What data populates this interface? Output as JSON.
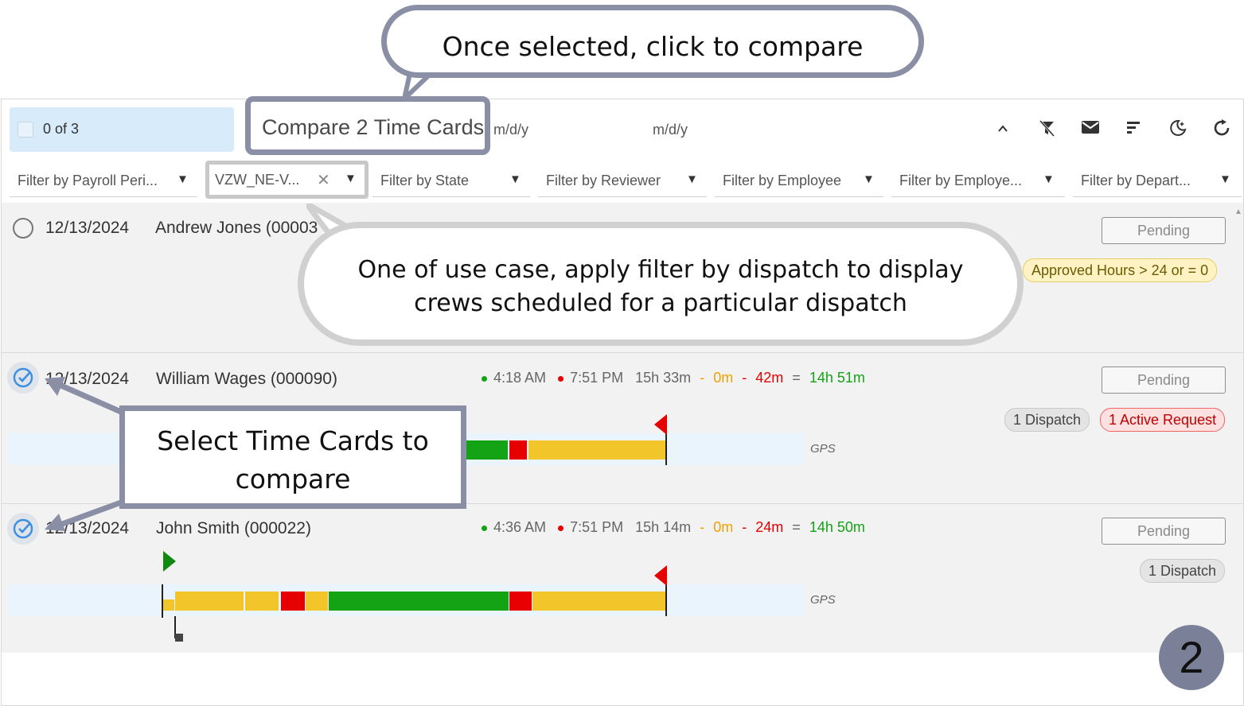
{
  "selection": {
    "count_label": "0 of 3"
  },
  "compare_button": {
    "label": "Compare 2 Time Cards"
  },
  "dates": {
    "start_placeholder": "m/d/y",
    "end_placeholder": "m/d/y"
  },
  "filters": [
    {
      "label": "Filter by Payroll Peri..."
    },
    {
      "label": "VZW_NE-V...",
      "clear": "✕"
    },
    {
      "label": "Filter by State"
    },
    {
      "label": "Filter by Reviewer"
    },
    {
      "label": "Filter by Employee"
    },
    {
      "label": "Filter by Employe..."
    },
    {
      "label": "Filter by Depart..."
    }
  ],
  "rows": [
    {
      "date": "12/13/2024",
      "name": "Andrew Jones (00003",
      "status": "Pending",
      "chips": [
        "Approved Hours > 24 or = 0"
      ]
    },
    {
      "date": "12/13/2024",
      "name": "William Wages (000090)",
      "start": "4:18 AM",
      "end": "7:51 PM",
      "total": "15h 33m",
      "sep1": "-",
      "break": "0m",
      "sep2": "-",
      "deduct": "42m",
      "eq": "=",
      "net": "14h 51m",
      "status": "Pending",
      "chips": [
        "1 Dispatch",
        "1 Active Request"
      ],
      "gps": "GPS"
    },
    {
      "date": "12/13/2024",
      "name": "John Smith (000022)",
      "start": "4:36 AM",
      "end": "7:51 PM",
      "total": "15h 14m",
      "sep1": "-",
      "break": "0m",
      "sep2": "-",
      "deduct": "24m",
      "eq": "=",
      "net": "14h 50m",
      "status": "Pending",
      "chips": [
        "1 Dispatch"
      ],
      "gps": "GPS"
    }
  ],
  "annotations": {
    "top": "Once selected, click to compare",
    "middle_line1": "One of use case, apply filter by dispatch to display",
    "middle_line2": "crews scheduled for a particular dispatch",
    "left_line1": "Select Time Cards to",
    "left_line2": "compare",
    "step": "2"
  },
  "colors": {
    "accent": "#d7ebfb",
    "green": "#14a314",
    "red": "#e60000",
    "yellow": "#f2c62a",
    "orange": "#f0a000",
    "annotation_border": "#8a8fa6"
  }
}
